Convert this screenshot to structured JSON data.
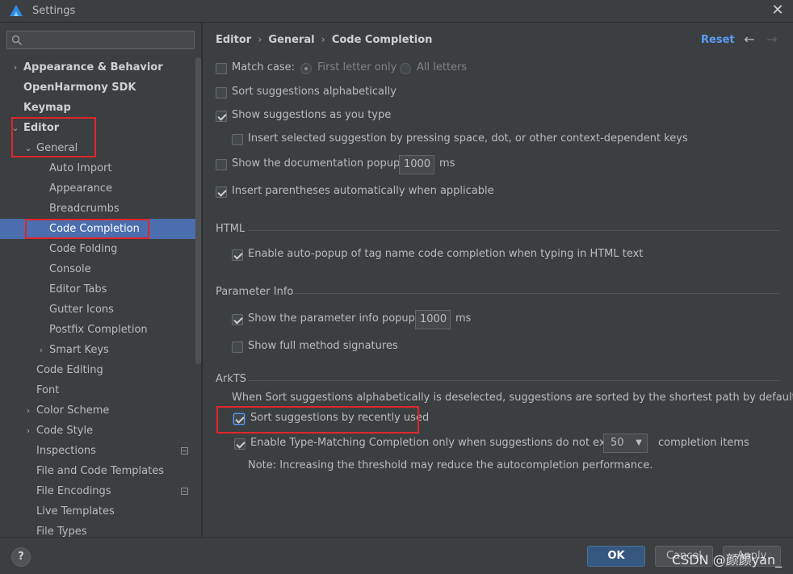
{
  "window": {
    "title": "Settings",
    "close_glyph": "✕"
  },
  "search": {
    "placeholder": "",
    "icon": "search-icon"
  },
  "tree": [
    {
      "label": "Appearance & Behavior",
      "bold": true,
      "arrow": "›",
      "level": 0
    },
    {
      "label": "OpenHarmony SDK",
      "bold": true,
      "arrow": "",
      "level": 0
    },
    {
      "label": "Keymap",
      "bold": true,
      "arrow": "",
      "level": 0
    },
    {
      "label": "Editor",
      "bold": true,
      "arrow": "⌄",
      "level": 0
    },
    {
      "label": "General",
      "bold": false,
      "arrow": "⌄",
      "level": 1
    },
    {
      "label": "Auto Import",
      "bold": false,
      "arrow": "",
      "level": 2
    },
    {
      "label": "Appearance",
      "bold": false,
      "arrow": "",
      "level": 2
    },
    {
      "label": "Breadcrumbs",
      "bold": false,
      "arrow": "",
      "level": 2
    },
    {
      "label": "Code Completion",
      "bold": false,
      "arrow": "",
      "level": 2,
      "selected": true
    },
    {
      "label": "Code Folding",
      "bold": false,
      "arrow": "",
      "level": 2
    },
    {
      "label": "Console",
      "bold": false,
      "arrow": "",
      "level": 2
    },
    {
      "label": "Editor Tabs",
      "bold": false,
      "arrow": "",
      "level": 2
    },
    {
      "label": "Gutter Icons",
      "bold": false,
      "arrow": "",
      "level": 2
    },
    {
      "label": "Postfix Completion",
      "bold": false,
      "arrow": "",
      "level": 2
    },
    {
      "label": "Smart Keys",
      "bold": false,
      "arrow": "›",
      "level": 2
    },
    {
      "label": "Code Editing",
      "bold": false,
      "arrow": "",
      "level": 1
    },
    {
      "label": "Font",
      "bold": false,
      "arrow": "",
      "level": 1
    },
    {
      "label": "Color Scheme",
      "bold": false,
      "arrow": "›",
      "level": 1
    },
    {
      "label": "Code Style",
      "bold": false,
      "arrow": "›",
      "level": 1
    },
    {
      "label": "Inspections",
      "bold": false,
      "arrow": "",
      "level": 1,
      "badge": true
    },
    {
      "label": "File and Code Templates",
      "bold": false,
      "arrow": "",
      "level": 1
    },
    {
      "label": "File Encodings",
      "bold": false,
      "arrow": "",
      "level": 1,
      "badge": true
    },
    {
      "label": "Live Templates",
      "bold": false,
      "arrow": "",
      "level": 1
    },
    {
      "label": "File Types",
      "bold": false,
      "arrow": "",
      "level": 1
    }
  ],
  "breadcrumb": {
    "items": [
      "Editor",
      "General",
      "Code Completion"
    ],
    "separator": "›"
  },
  "header": {
    "reset": "Reset",
    "back_glyph": "←",
    "forward_glyph": "→"
  },
  "options": {
    "match_case": {
      "label": "Match case:",
      "checked": false
    },
    "first_letter_only": {
      "label": "First letter only",
      "selected": true
    },
    "all_letters": {
      "label": "All letters",
      "selected": false
    },
    "sort_alpha": {
      "label": "Sort suggestions alphabetically",
      "checked": false
    },
    "show_as_type": {
      "label": "Show suggestions as you type",
      "checked": true
    },
    "insert_selected": {
      "label": "Insert selected suggestion by pressing space, dot, or other context-dependent keys",
      "checked": false
    },
    "doc_popup": {
      "label_before": "Show the documentation popup in",
      "value": "1000",
      "unit": "ms",
      "checked": false
    },
    "insert_parens": {
      "label": "Insert parentheses automatically when applicable",
      "checked": true
    }
  },
  "html_section": {
    "title": "HTML",
    "auto_popup": {
      "label": "Enable auto-popup of tag name code completion when typing in HTML text",
      "checked": true
    }
  },
  "param_section": {
    "title": "Parameter Info",
    "show_popup": {
      "label_before": "Show the parameter info popup in",
      "value": "1000",
      "unit": "ms",
      "checked": true
    },
    "full_signatures": {
      "label": "Show full method signatures",
      "checked": false
    }
  },
  "arkts_section": {
    "title": "ArkTS",
    "description": "When Sort suggestions alphabetically is deselected, suggestions are sorted by the shortest path by default",
    "sort_recent": {
      "label": "Sort suggestions by recently used",
      "checked": true
    },
    "type_matching": {
      "label": "Enable Type-Matching Completion only when suggestions do not exceed",
      "value": "50",
      "suffix": "completion items",
      "checked": true
    },
    "note": "Note: Increasing the threshold may reduce the autocompletion performance."
  },
  "footer": {
    "help": "?",
    "ok": "OK",
    "cancel": "Cancel",
    "apply": "Apply"
  },
  "watermark": "CSDN @颜颜yan_",
  "colors": {
    "accent": "#589df6",
    "selection": "#4b6eaf",
    "highlight_box": "#e0262a",
    "ok_button": "#365880"
  }
}
